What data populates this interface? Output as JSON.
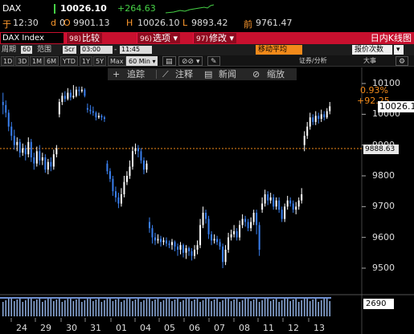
{
  "quote": {
    "ticker": "DAX",
    "last": "10026.10",
    "change": "+264.63",
    "yu": "于",
    "time": "12:30",
    "d_label": "d",
    "d_val": "0",
    "open_label": "O",
    "open": "9901.13",
    "high_label": "H",
    "high": "10026.10",
    "low_label": "L",
    "low": "9893.42",
    "prev_label": "前",
    "prev": "9761.47"
  },
  "command": {
    "security": "DAX Index",
    "buttons": [
      {
        "num": "98)",
        "label": "比较"
      },
      {
        "num": "96)",
        "label": "选项 ▾"
      },
      {
        "num": "97)",
        "label": "修改 ▾"
      }
    ],
    "title": "日内K线图"
  },
  "toolbar1": {
    "period_label": "周期",
    "period_value": "60",
    "range_label": "范围",
    "range_value": "Scr",
    "start_time": "03:00",
    "dash": "-",
    "end_time": "11:45",
    "moving_avg": "移动平均",
    "event_label": "报价次数",
    "event_dropdown": "▾"
  },
  "toolbar2": {
    "periods": [
      "1D",
      "3D",
      "1M",
      "6M",
      "YTD",
      "1Y",
      "5Y",
      "Max"
    ],
    "interval": "60 Min ▾",
    "chart_icon": "▤",
    "link_icon": "⊘⊘ ▾",
    "edit_icon": "✎",
    "securities": "证券/分析",
    "bigger": "大事",
    "extra": "⚙"
  },
  "annotations": {
    "track": "追踪",
    "annotate": "注释",
    "news": "新闻",
    "zoom": "缩放"
  },
  "colors": {
    "accent_red": "#c8102e",
    "orange": "#f28a1a",
    "up": "#ffffff",
    "down": "#3a80f0",
    "green": "#46d146"
  },
  "chart_data": {
    "type": "candlestick",
    "y_ticks": [
      "10100",
      "10000",
      "9900",
      "9800",
      "9700",
      "9600",
      "9500"
    ],
    "ylim": [
      9450,
      10150
    ],
    "x_ticks": [
      "24",
      "29",
      "30",
      "31",
      "01",
      "04",
      "05",
      "06",
      "07",
      "08",
      "11",
      "12",
      "13"
    ],
    "last_price": "10026.10",
    "reference_price": "9888.63",
    "change_pct": "0.93%",
    "change_abs": "+92.25",
    "volume_label": "2690",
    "reference_line": 9888.63,
    "candles": [
      [
        10040,
        10030,
        10070,
        10000
      ],
      [
        10030,
        10005,
        10045,
        9990
      ],
      [
        10005,
        9960,
        10015,
        9945
      ],
      [
        9960,
        9930,
        9975,
        9915
      ],
      [
        9930,
        9900,
        9950,
        9885
      ],
      [
        9900,
        9910,
        9925,
        9880
      ],
      [
        9910,
        9875,
        9920,
        9860
      ],
      [
        9875,
        9890,
        9905,
        9865
      ],
      [
        9890,
        9870,
        9900,
        9850
      ],
      [
        9870,
        9910,
        9925,
        9860
      ],
      [
        9910,
        9860,
        9920,
        9845
      ],
      [
        9860,
        9840,
        9875,
        9820
      ],
      [
        9840,
        9880,
        9895,
        9830
      ],
      [
        9880,
        9850,
        9900,
        9835
      ],
      [
        9850,
        9860,
        9875,
        9835
      ],
      [
        9860,
        9820,
        9870,
        9810
      ],
      [
        9820,
        9845,
        9855,
        9805
      ],
      [
        9845,
        9830,
        9860,
        9815
      ],
      [
        9830,
        9870,
        9885,
        9820
      ],
      [
        9870,
        9890,
        9900,
        9860
      ],
      [
        10000,
        10040,
        10050,
        9990
      ],
      [
        10040,
        10060,
        10070,
        10030
      ],
      [
        10060,
        10050,
        10075,
        10040
      ],
      [
        10050,
        10070,
        10085,
        10045
      ],
      [
        10070,
        10055,
        10080,
        10045
      ],
      [
        10055,
        10060,
        10095,
        10050
      ],
      [
        10060,
        10080,
        10090,
        10055
      ],
      [
        10080,
        10075,
        10090,
        10060
      ],
      [
        10075,
        10080,
        10090,
        10070
      ],
      [
        10080,
        10060,
        10085,
        10055
      ],
      [
        10020,
        10015,
        10035,
        10005
      ],
      [
        10015,
        10010,
        10030,
        10000
      ],
      [
        10010,
        10005,
        10025,
        9995
      ],
      [
        10005,
        9990,
        10010,
        9980
      ],
      [
        9990,
        9995,
        10005,
        9985
      ],
      [
        9995,
        9990,
        10000,
        9980
      ],
      [
        9990,
        9985,
        9995,
        9975
      ],
      [
        9840,
        9815,
        9850,
        9805
      ],
      [
        9815,
        9790,
        9825,
        9780
      ],
      [
        9790,
        9750,
        9800,
        9735
      ],
      [
        9750,
        9730,
        9765,
        9715
      ],
      [
        9730,
        9710,
        9745,
        9695
      ],
      [
        9710,
        9740,
        9760,
        9700
      ],
      [
        9740,
        9780,
        9800,
        9730
      ],
      [
        9780,
        9800,
        9815,
        9770
      ],
      [
        9800,
        9830,
        9850,
        9790
      ],
      [
        9830,
        9880,
        9895,
        9820
      ],
      [
        9880,
        9890,
        9905,
        9870
      ],
      [
        9890,
        9880,
        9900,
        9860
      ],
      [
        9880,
        9850,
        9890,
        9840
      ],
      [
        9850,
        9820,
        9860,
        9805
      ],
      [
        9820,
        9840,
        9850,
        9810
      ],
      [
        9650,
        9630,
        9665,
        9615
      ],
      [
        9630,
        9600,
        9640,
        9580
      ],
      [
        9600,
        9590,
        9615,
        9575
      ],
      [
        9590,
        9595,
        9610,
        9580
      ],
      [
        9595,
        9585,
        9605,
        9570
      ],
      [
        9585,
        9590,
        9600,
        9575
      ],
      [
        9590,
        9580,
        9600,
        9570
      ],
      [
        9580,
        9575,
        9590,
        9565
      ],
      [
        9575,
        9585,
        9595,
        9560
      ],
      [
        9585,
        9570,
        9590,
        9555
      ],
      [
        9570,
        9560,
        9580,
        9540
      ],
      [
        9560,
        9575,
        9585,
        9545
      ],
      [
        9575,
        9550,
        9580,
        9535
      ],
      [
        9550,
        9565,
        9575,
        9530
      ],
      [
        9565,
        9555,
        9570,
        9540
      ],
      [
        9555,
        9540,
        9565,
        9525
      ],
      [
        9540,
        9560,
        9575,
        9530
      ],
      [
        9560,
        9575,
        9590,
        9545
      ],
      [
        9575,
        9640,
        9660,
        9565
      ],
      [
        9640,
        9680,
        9700,
        9630
      ],
      [
        9680,
        9660,
        9690,
        9645
      ],
      [
        9660,
        9610,
        9670,
        9595
      ],
      [
        9610,
        9590,
        9620,
        9575
      ],
      [
        9590,
        9595,
        9610,
        9580
      ],
      [
        9595,
        9585,
        9605,
        9575
      ],
      [
        9585,
        9570,
        9595,
        9560
      ],
      [
        9570,
        9520,
        9580,
        9500
      ],
      [
        9520,
        9560,
        9575,
        9510
      ],
      [
        9560,
        9600,
        9615,
        9550
      ],
      [
        9600,
        9610,
        9625,
        9590
      ],
      [
        9610,
        9620,
        9640,
        9600
      ],
      [
        9620,
        9600,
        9630,
        9590
      ],
      [
        9600,
        9640,
        9655,
        9590
      ],
      [
        9640,
        9660,
        9675,
        9630
      ],
      [
        9660,
        9650,
        9670,
        9635
      ],
      [
        9650,
        9630,
        9660,
        9620
      ],
      [
        9630,
        9650,
        9665,
        9620
      ],
      [
        9650,
        9680,
        9690,
        9640
      ],
      [
        9680,
        9640,
        9690,
        9610
      ],
      [
        9640,
        9560,
        9650,
        9540
      ],
      [
        9690,
        9710,
        9730,
        9680
      ],
      [
        9710,
        9740,
        9755,
        9700
      ],
      [
        9740,
        9720,
        9750,
        9705
      ],
      [
        9720,
        9730,
        9745,
        9710
      ],
      [
        9730,
        9700,
        9740,
        9690
      ],
      [
        9700,
        9720,
        9730,
        9690
      ],
      [
        9720,
        9690,
        9730,
        9680
      ],
      [
        9690,
        9660,
        9700,
        9650
      ],
      [
        9660,
        9700,
        9710,
        9650
      ],
      [
        9700,
        9720,
        9735,
        9690
      ],
      [
        9720,
        9710,
        9730,
        9700
      ],
      [
        9710,
        9690,
        9720,
        9680
      ],
      [
        9690,
        9700,
        9715,
        9675
      ],
      [
        9700,
        9720,
        9730,
        9690
      ],
      [
        9720,
        9740,
        9760,
        9710
      ],
      [
        9900,
        9930,
        9945,
        9880
      ],
      [
        9930,
        9960,
        9975,
        9920
      ],
      [
        9960,
        9990,
        10005,
        9950
      ],
      [
        9990,
        9975,
        10000,
        9965
      ],
      [
        9975,
        9995,
        10010,
        9965
      ],
      [
        9995,
        9985,
        10005,
        9970
      ],
      [
        9985,
        10000,
        10015,
        9975
      ],
      [
        10000,
        9990,
        10010,
        9980
      ],
      [
        9990,
        10010,
        10020,
        9985
      ],
      [
        10010,
        10026,
        10040,
        10000
      ]
    ]
  }
}
